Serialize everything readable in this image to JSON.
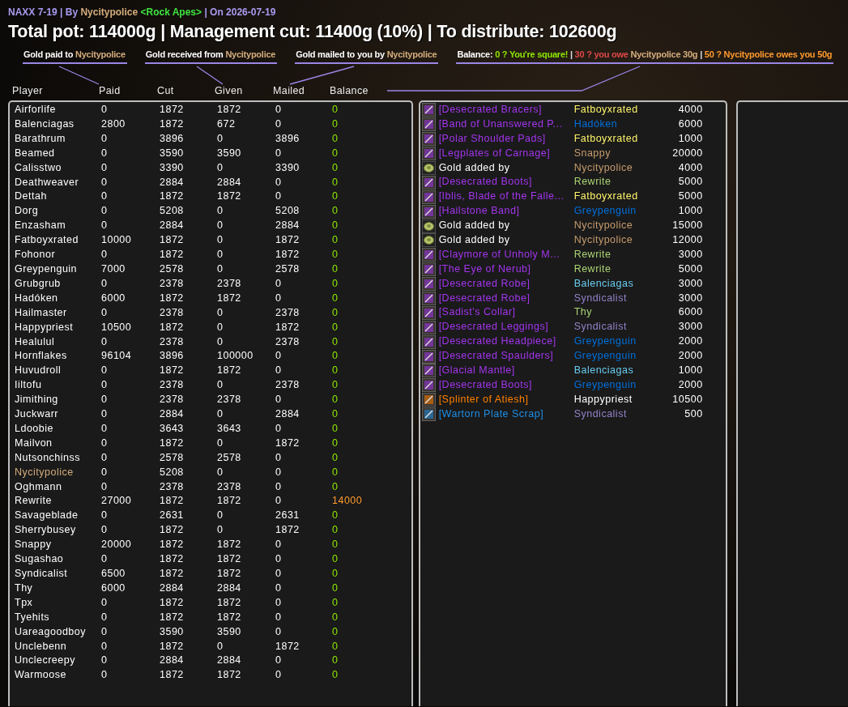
{
  "header": {
    "title_parts": [
      {
        "text": "NAXX 7-19 | By",
        "color": "#a99bf0"
      },
      {
        "text": "Nycitypolice",
        "color": "#d5ad7d"
      },
      {
        "text": "<Rock Apes>",
        "color": "#3fe43f"
      },
      {
        "text": "| On 2026-07-19",
        "color": "#a99bf0"
      }
    ],
    "summary": "Total pot: 114000g | Management cut: 11400g (10%) | To distribute: 102600g"
  },
  "legends": [
    {
      "parts": [
        {
          "text": "Gold paid to",
          "color": "#ffffff"
        },
        {
          "text": "Nycitypolice",
          "color": "#d5ad7d"
        }
      ]
    },
    {
      "parts": [
        {
          "text": "Gold received from",
          "color": "#ffffff"
        },
        {
          "text": "Nycitypolice",
          "color": "#d5ad7d"
        }
      ]
    },
    {
      "parts": [
        {
          "text": "Gold mailed to you by",
          "color": "#ffffff"
        },
        {
          "text": "Nycitypolice",
          "color": "#d5ad7d"
        }
      ]
    },
    {
      "parts": [
        {
          "text": "Balance:",
          "color": "#ffffff"
        },
        {
          "text": "0 ? You're square!",
          "color": "#8fe800"
        },
        {
          "text": "|"
        },
        {
          "text": "30 ? you owe",
          "color": "#e04848"
        },
        {
          "text": "Nycitypolice 30g",
          "color": "#d5ad7d"
        },
        {
          "text": "|"
        },
        {
          "text": "50 ? Nycitypolice owes you 50g",
          "color": "#ff9a2e"
        }
      ]
    }
  ],
  "columns": [
    "Player",
    "Paid",
    "Cut",
    "Given",
    "Mailed",
    "Balance"
  ],
  "players": [
    {
      "name": "Airforlife",
      "paid": "0",
      "cut": "1872",
      "given": "1872",
      "mailed": "0",
      "balance": "0",
      "manager": false,
      "square": true
    },
    {
      "name": "Balenciagas",
      "paid": "2800",
      "cut": "1872",
      "given": "672",
      "mailed": "0",
      "balance": "0",
      "manager": false,
      "square": true
    },
    {
      "name": "Barathrum",
      "paid": "0",
      "cut": "3896",
      "given": "0",
      "mailed": "3896",
      "balance": "0",
      "manager": false,
      "square": true
    },
    {
      "name": "Beamed",
      "paid": "0",
      "cut": "3590",
      "given": "3590",
      "mailed": "0",
      "balance": "0",
      "manager": false,
      "square": true
    },
    {
      "name": "Calisstwo",
      "paid": "0",
      "cut": "3390",
      "given": "0",
      "mailed": "3390",
      "balance": "0",
      "manager": false,
      "square": true
    },
    {
      "name": "Deathweaver",
      "paid": "0",
      "cut": "2884",
      "given": "2884",
      "mailed": "0",
      "balance": "0",
      "manager": false,
      "square": true
    },
    {
      "name": "Dettah",
      "paid": "0",
      "cut": "1872",
      "given": "1872",
      "mailed": "0",
      "balance": "0",
      "manager": false,
      "square": true
    },
    {
      "name": "Dorg",
      "paid": "0",
      "cut": "5208",
      "given": "0",
      "mailed": "5208",
      "balance": "0",
      "manager": false,
      "square": true
    },
    {
      "name": "Enzasham",
      "paid": "0",
      "cut": "2884",
      "given": "0",
      "mailed": "2884",
      "balance": "0",
      "manager": false,
      "square": true
    },
    {
      "name": "Fatboyxrated",
      "paid": "10000",
      "cut": "1872",
      "given": "0",
      "mailed": "1872",
      "balance": "0",
      "manager": false,
      "square": true
    },
    {
      "name": "Fohonor",
      "paid": "0",
      "cut": "1872",
      "given": "0",
      "mailed": "1872",
      "balance": "0",
      "manager": false,
      "square": true
    },
    {
      "name": "Greypenguin",
      "paid": "7000",
      "cut": "2578",
      "given": "0",
      "mailed": "2578",
      "balance": "0",
      "manager": false,
      "square": true
    },
    {
      "name": "Grubgrub",
      "paid": "0",
      "cut": "2378",
      "given": "2378",
      "mailed": "0",
      "balance": "0",
      "manager": false,
      "square": true
    },
    {
      "name": "Hadóken",
      "paid": "6000",
      "cut": "1872",
      "given": "1872",
      "mailed": "0",
      "balance": "0",
      "manager": false,
      "square": true
    },
    {
      "name": "Hailmaster",
      "paid": "0",
      "cut": "2378",
      "given": "0",
      "mailed": "2378",
      "balance": "0",
      "manager": false,
      "square": true
    },
    {
      "name": "Happypriest",
      "paid": "10500",
      "cut": "1872",
      "given": "0",
      "mailed": "1872",
      "balance": "0",
      "manager": false,
      "square": true
    },
    {
      "name": "Healulul",
      "paid": "0",
      "cut": "2378",
      "given": "0",
      "mailed": "2378",
      "balance": "0",
      "manager": false,
      "square": true
    },
    {
      "name": "Hornflakes",
      "paid": "96104",
      "cut": "3896",
      "given": "100000",
      "mailed": "0",
      "balance": "0",
      "manager": false,
      "square": true
    },
    {
      "name": "Huvudroll",
      "paid": "0",
      "cut": "1872",
      "given": "1872",
      "mailed": "0",
      "balance": "0",
      "manager": false,
      "square": true
    },
    {
      "name": "Iiltofu",
      "paid": "0",
      "cut": "2378",
      "given": "0",
      "mailed": "2378",
      "balance": "0",
      "manager": false,
      "square": true
    },
    {
      "name": "Jimithing",
      "paid": "0",
      "cut": "2378",
      "given": "2378",
      "mailed": "0",
      "balance": "0",
      "manager": false,
      "square": true
    },
    {
      "name": "Juckwarr",
      "paid": "0",
      "cut": "2884",
      "given": "0",
      "mailed": "2884",
      "balance": "0",
      "manager": false,
      "square": true
    },
    {
      "name": "Ldoobie",
      "paid": "0",
      "cut": "3643",
      "given": "3643",
      "mailed": "0",
      "balance": "0",
      "manager": false,
      "square": true
    },
    {
      "name": "Mailvon",
      "paid": "0",
      "cut": "1872",
      "given": "0",
      "mailed": "1872",
      "balance": "0",
      "manager": false,
      "square": true
    },
    {
      "name": "Nutsonchinss",
      "paid": "0",
      "cut": "2578",
      "given": "2578",
      "mailed": "0",
      "balance": "0",
      "manager": false,
      "square": true
    },
    {
      "name": "Nycitypolice",
      "paid": "0",
      "cut": "5208",
      "given": "0",
      "mailed": "0",
      "balance": "0",
      "manager": true,
      "square": true
    },
    {
      "name": "Oghmann",
      "paid": "0",
      "cut": "2378",
      "given": "2378",
      "mailed": "0",
      "balance": "0",
      "manager": false,
      "square": true
    },
    {
      "name": "Rewrite",
      "paid": "27000",
      "cut": "1872",
      "given": "1872",
      "mailed": "0",
      "balance": "14000",
      "manager": false,
      "square": false
    },
    {
      "name": "Savageblade",
      "paid": "0",
      "cut": "2631",
      "given": "0",
      "mailed": "2631",
      "balance": "0",
      "manager": false,
      "square": true
    },
    {
      "name": "Sherrybusey",
      "paid": "0",
      "cut": "1872",
      "given": "0",
      "mailed": "1872",
      "balance": "0",
      "manager": false,
      "square": true
    },
    {
      "name": "Snappy",
      "paid": "20000",
      "cut": "1872",
      "given": "1872",
      "mailed": "0",
      "balance": "0",
      "manager": false,
      "square": true
    },
    {
      "name": "Sugashao",
      "paid": "0",
      "cut": "1872",
      "given": "1872",
      "mailed": "0",
      "balance": "0",
      "manager": false,
      "square": true
    },
    {
      "name": "Syndicalist",
      "paid": "6500",
      "cut": "1872",
      "given": "1872",
      "mailed": "0",
      "balance": "0",
      "manager": false,
      "square": true
    },
    {
      "name": "Thy",
      "paid": "6000",
      "cut": "2884",
      "given": "2884",
      "mailed": "0",
      "balance": "0",
      "manager": false,
      "square": true
    },
    {
      "name": "Tpx",
      "paid": "0",
      "cut": "1872",
      "given": "1872",
      "mailed": "0",
      "balance": "0",
      "manager": false,
      "square": true
    },
    {
      "name": "Tyehits",
      "paid": "0",
      "cut": "1872",
      "given": "1872",
      "mailed": "0",
      "balance": "0",
      "manager": false,
      "square": true
    },
    {
      "name": "Uareagoodboy",
      "paid": "0",
      "cut": "3590",
      "given": "3590",
      "mailed": "0",
      "balance": "0",
      "manager": false,
      "square": true
    },
    {
      "name": "Unclebenn",
      "paid": "0",
      "cut": "1872",
      "given": "0",
      "mailed": "1872",
      "balance": "0",
      "manager": false,
      "square": true
    },
    {
      "name": "Unclecreepy",
      "paid": "0",
      "cut": "2884",
      "given": "2884",
      "mailed": "0",
      "balance": "0",
      "manager": false,
      "square": true
    },
    {
      "name": "Warmoose",
      "paid": "0",
      "cut": "1872",
      "given": "1872",
      "mailed": "0",
      "balance": "0",
      "manager": false,
      "square": true
    }
  ],
  "loot": [
    {
      "kind": "epic",
      "name": "[Desecrated Bracers]",
      "winner": "Fatboyxrated",
      "color": "#fff569",
      "amount": "4000"
    },
    {
      "kind": "epic",
      "name": "[Band of Unanswered P...",
      "winner": "Hadóken",
      "color": "#0070de",
      "amount": "6000"
    },
    {
      "kind": "epic",
      "name": "[Polar Shoulder Pads]",
      "winner": "Fatboyxrated",
      "color": "#fff569",
      "amount": "1000"
    },
    {
      "kind": "epic",
      "name": "[Legplates of Carnage]",
      "winner": "Snappy",
      "color": "#c79c6e",
      "amount": "20000"
    },
    {
      "kind": "coin",
      "name": "Gold added by",
      "winner": "Nycitypolice",
      "color": "#c79c6e",
      "amount": "4000"
    },
    {
      "kind": "epic",
      "name": "[Desecrated Boots]",
      "winner": "Rewrite",
      "color": "#abd473",
      "amount": "5000"
    },
    {
      "kind": "epic",
      "name": "[Iblis, Blade of the Falle...",
      "winner": "Fatboyxrated",
      "color": "#fff569",
      "amount": "5000"
    },
    {
      "kind": "epic",
      "name": "[Hailstone Band]",
      "winner": "Greypenguin",
      "color": "#0070de",
      "amount": "1000"
    },
    {
      "kind": "coin",
      "name": "Gold added by",
      "winner": "Nycitypolice",
      "color": "#c79c6e",
      "amount": "15000"
    },
    {
      "kind": "coin",
      "name": "Gold added by",
      "winner": "Nycitypolice",
      "color": "#c79c6e",
      "amount": "12000"
    },
    {
      "kind": "epic",
      "name": "[Claymore of Unholy M...",
      "winner": "Rewrite",
      "color": "#abd473",
      "amount": "3000"
    },
    {
      "kind": "epic",
      "name": "[The Eye of Nerub]",
      "winner": "Rewrite",
      "color": "#abd473",
      "amount": "5000"
    },
    {
      "kind": "epic",
      "name": "[Desecrated Robe]",
      "winner": "Balenciagas",
      "color": "#69ccf0",
      "amount": "3000"
    },
    {
      "kind": "epic",
      "name": "[Desecrated Robe]",
      "winner": "Syndicalist",
      "color": "#9482c9",
      "amount": "3000"
    },
    {
      "kind": "epic",
      "name": "[Sadist's Collar]",
      "winner": "Thy",
      "color": "#abd473",
      "amount": "6000"
    },
    {
      "kind": "epic",
      "name": "[Desecrated Leggings]",
      "winner": "Syndicalist",
      "color": "#9482c9",
      "amount": "3000"
    },
    {
      "kind": "epic",
      "name": "[Desecrated Headpiece]",
      "winner": "Greypenguin",
      "color": "#0070de",
      "amount": "2000"
    },
    {
      "kind": "epic",
      "name": "[Desecrated Spaulders]",
      "winner": "Greypenguin",
      "color": "#0070de",
      "amount": "2000"
    },
    {
      "kind": "epic",
      "name": "[Glacial Mantle]",
      "winner": "Balenciagas",
      "color": "#69ccf0",
      "amount": "1000"
    },
    {
      "kind": "epic",
      "name": "[Desecrated Boots]",
      "winner": "Greypenguin",
      "color": "#0070de",
      "amount": "2000"
    },
    {
      "kind": "legendary",
      "name": "[Splinter of Atiesh]",
      "winner": "Happypriest",
      "color": "#ffffff",
      "amount": "10500"
    },
    {
      "kind": "rare",
      "name": "[Wartorn Plate Scrap]",
      "winner": "Syndicalist",
      "color": "#9482c9",
      "amount": "500"
    }
  ]
}
